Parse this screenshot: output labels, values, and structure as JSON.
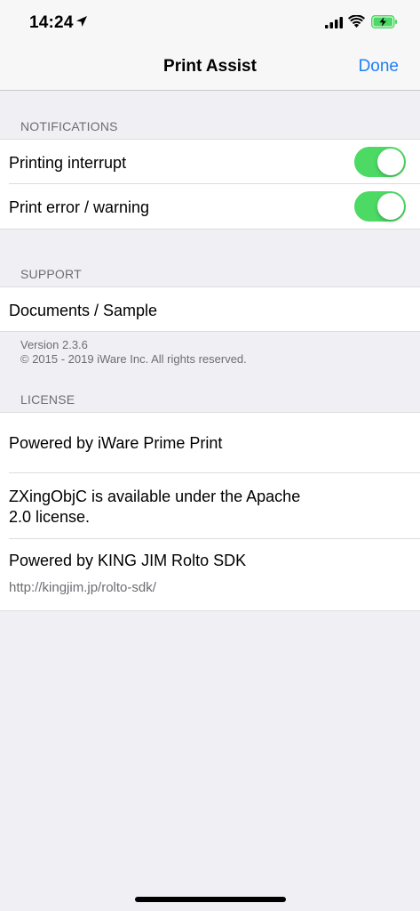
{
  "status_bar": {
    "time": "14:24",
    "icons": [
      "location-arrow-icon",
      "signal-icon",
      "wifi-icon",
      "battery-charging-icon"
    ]
  },
  "nav": {
    "title": "Print Assist",
    "done_label": "Done"
  },
  "notifications": {
    "header": "NOTIFICATIONS",
    "items": [
      {
        "label": "Printing interrupt",
        "enabled": true
      },
      {
        "label": "Print error / warning",
        "enabled": true
      }
    ]
  },
  "support": {
    "header": "SUPPORT",
    "items": [
      {
        "label": "Documents / Sample"
      }
    ],
    "version": "Version 2.3.6",
    "copyright": "© 2015 - 2019 iWare Inc. All rights reserved."
  },
  "license": {
    "header": "LICENSE",
    "items": [
      {
        "label": "Powered by iWare Prime Print"
      },
      {
        "label_line1": "ZXingObjC is available under the Apache",
        "label_line2": "2.0 license."
      },
      {
        "label": "Powered by KING JIM Rolto SDK",
        "sub": "http://kingjim.jp/rolto-sdk/"
      }
    ]
  },
  "colors": {
    "accent": "#1f7ff5",
    "toggle_on": "#4cd964",
    "background": "#efeff4",
    "battery_charging": "#4cd964"
  }
}
